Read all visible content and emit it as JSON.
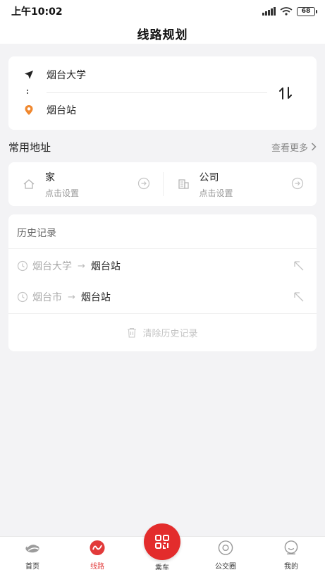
{
  "status_bar": {
    "time": "上午10:02",
    "battery": "68"
  },
  "nav": {
    "title": "线路规划"
  },
  "route": {
    "from": "烟台大学",
    "to": "烟台站"
  },
  "common": {
    "title": "常用地址",
    "more": "查看更多 ",
    "home": {
      "label": "家",
      "sub": "点击设置"
    },
    "company": {
      "label": "公司",
      "sub": "点击设置"
    }
  },
  "history": {
    "title": "历史记录",
    "items": [
      {
        "from": "烟台大学",
        "arrow": "→",
        "to": "烟台站"
      },
      {
        "from": "烟台市",
        "arrow": "→",
        "to": "烟台站"
      }
    ],
    "clear_label": "清除历史记录"
  },
  "tabs": [
    {
      "label": "首页"
    },
    {
      "label": "线路"
    },
    {
      "label": "乘车"
    },
    {
      "label": "公交圈"
    },
    {
      "label": "我的"
    }
  ],
  "colors": {
    "accent": "#e23a3a",
    "pin": "#f0882f"
  }
}
